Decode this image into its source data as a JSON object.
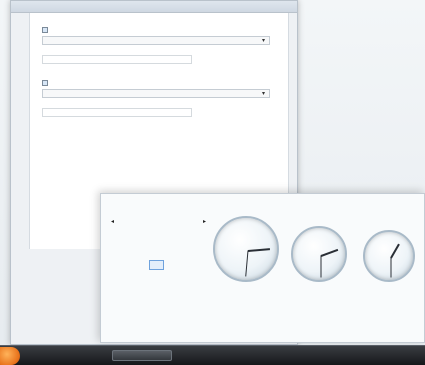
{
  "settings": {
    "title": "",
    "intro": "",
    "groups": [
      {
        "checkbox_label": "",
        "select_label": "",
        "select_value": "",
        "text_label": "",
        "text_value": ""
      },
      {
        "checkbox_label": "",
        "select_label": "",
        "select_value": "",
        "text_label": "",
        "text_value": ""
      }
    ],
    "status_link": ""
  },
  "flyout": {
    "date_link": "",
    "calendar": {
      "month": "",
      "days_of_week": [
        "",
        "",
        "",
        "",
        "",
        "",
        ""
      ],
      "weeks": [
        [
          "",
          "",
          "",
          "",
          "",
          "",
          ""
        ],
        [
          "",
          "",
          "",
          "",
          "",
          "",
          ""
        ],
        [
          "",
          "",
          "",
          "",
          "",
          "",
          ""
        ],
        [
          "",
          "",
          "",
          "",
          "",
          "",
          ""
        ],
        [
          "",
          "",
          "",
          "",
          "",
          "",
          ""
        ],
        [
          "",
          "",
          "",
          "",
          "",
          "",
          ""
        ]
      ],
      "today_value": ""
    },
    "clocks": [
      {
        "label": "",
        "sublabel": ""
      },
      {
        "label": "",
        "sublabel": ""
      },
      {
        "label": "",
        "sublabel": ""
      }
    ],
    "settings_link": ""
  },
  "taskbar": {
    "start_icon": "windows-orb-icon",
    "items": [
      {
        "label": ""
      },
      {
        "label": ""
      }
    ],
    "tray": [
      "",
      "",
      ""
    ]
  },
  "colors": {
    "accent_link": "#3b74c7",
    "taskbar": "#15171a",
    "start_orb": "#e8721b"
  }
}
